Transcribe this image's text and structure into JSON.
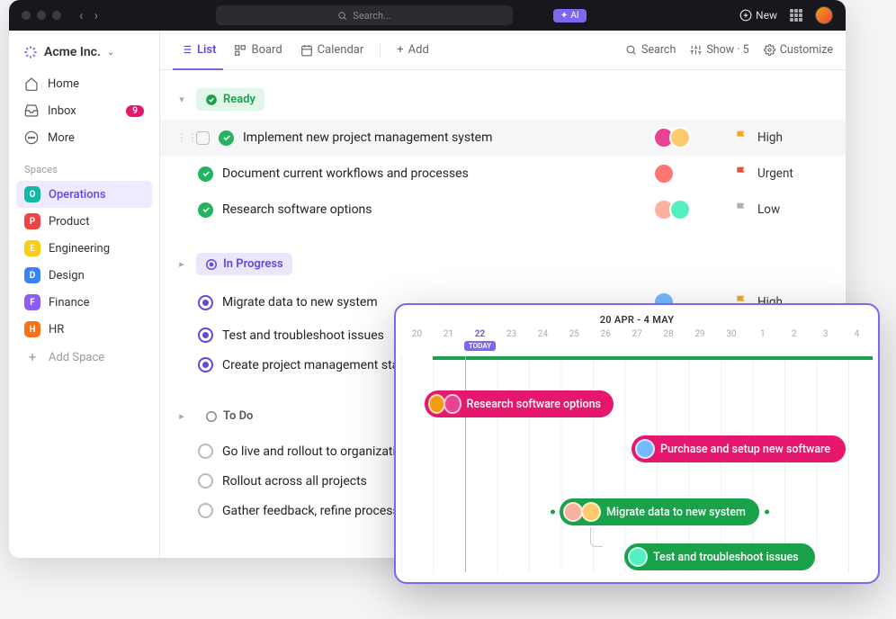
{
  "titlebar": {
    "search_placeholder": "Search...",
    "ai_label": "AI",
    "new_label": "New"
  },
  "workspace": {
    "name": "Acme Inc."
  },
  "nav": {
    "home": "Home",
    "inbox": "Inbox",
    "inbox_count": "9",
    "more": "More"
  },
  "spaces_label": "Spaces",
  "spaces": [
    {
      "initial": "O",
      "name": "Operations",
      "color": "#14b8a6"
    },
    {
      "initial": "P",
      "name": "Product",
      "color": "#ef4444"
    },
    {
      "initial": "E",
      "name": "Engineering",
      "color": "#facc15"
    },
    {
      "initial": "D",
      "name": "Design",
      "color": "#3b82f6"
    },
    {
      "initial": "F",
      "name": "Finance",
      "color": "#8b5cf6"
    },
    {
      "initial": "H",
      "name": "HR",
      "color": "#f97316"
    }
  ],
  "add_space_label": "Add Space",
  "views": {
    "list": "List",
    "board": "Board",
    "calendar": "Calendar",
    "add": "Add"
  },
  "toolbar": {
    "search": "Search",
    "show": "Show · 5",
    "customize": "Customize"
  },
  "groups": {
    "ready": "Ready",
    "inprogress": "In Progress",
    "todo": "To Do"
  },
  "priorities": {
    "high": "High",
    "urgent": "Urgent",
    "low": "Low"
  },
  "tasks": {
    "ready": [
      {
        "title": "Implement new project management system",
        "priority": "High",
        "flag_color": "#f5a623",
        "avatars": [
          "#e84393",
          "#fdcb6e"
        ]
      },
      {
        "title": "Document current workflows and processes",
        "priority": "Urgent",
        "flag_color": "#e74c3c",
        "avatars": [
          "#ff7675"
        ]
      },
      {
        "title": "Research software options",
        "priority": "Low",
        "flag_color": "#b0b0b0",
        "avatars": [
          "#fab1a0",
          "#55efc4"
        ]
      }
    ],
    "inprogress": [
      {
        "title": "Migrate data to new system",
        "priority": "High",
        "flag_color": "#f5a623",
        "avatars": [
          "#74b9ff"
        ]
      },
      {
        "title": "Test and troubleshoot issues"
      },
      {
        "title": "Create project management standards"
      }
    ],
    "todo": [
      {
        "title": "Go live and rollout to organization"
      },
      {
        "title": "Rollout across all projects"
      },
      {
        "title": "Gather feedback, refine process"
      }
    ]
  },
  "timeline": {
    "range": "20 APR - 4 MAY",
    "today_label": "TODAY",
    "days": [
      "20",
      "21",
      "22",
      "23",
      "24",
      "25",
      "26",
      "27",
      "28",
      "29",
      "30",
      "1",
      "2",
      "3",
      "4"
    ],
    "today_index": 2,
    "tasks": {
      "t1": "Research software options",
      "t2": "Purchase and setup new software",
      "t3": "Migrate data to new system",
      "t4": "Test and troubleshoot issues"
    }
  }
}
